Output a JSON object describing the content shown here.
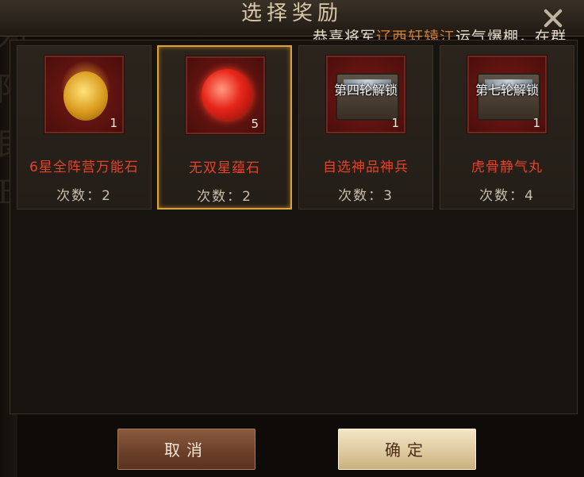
{
  "dialog": {
    "title": "选择奖励",
    "close_icon": "close-icon"
  },
  "ticker": {
    "prefix": "恭喜将军",
    "player": "辽西轩辕江",
    "suffix": "运气爆棚，在群",
    "highlight_color": "#d47a2e"
  },
  "rewards": [
    {
      "name": "6星全阵营万能石",
      "count": "1",
      "times_label": "次数：2",
      "icon": "gold-coin-icon",
      "selected": false,
      "lock_text": ""
    },
    {
      "name": "无双星蕴石",
      "count": "5",
      "times_label": "次数：2",
      "icon": "red-orb-icon",
      "selected": true,
      "lock_text": ""
    },
    {
      "name": "自选神品神兵",
      "count": "1",
      "times_label": "次数：3",
      "icon": "weapon-chest-icon",
      "selected": false,
      "lock_text": "第四轮解锁"
    },
    {
      "name": "虎骨静气丸",
      "count": "1",
      "times_label": "次数：4",
      "icon": "treasure-chest-icon",
      "selected": false,
      "lock_text": "第七轮解锁"
    }
  ],
  "buttons": {
    "cancel": "取消",
    "confirm": "确定"
  },
  "colors": {
    "reward_name": "#e2432c",
    "selected_border": "#d9a23a"
  }
}
